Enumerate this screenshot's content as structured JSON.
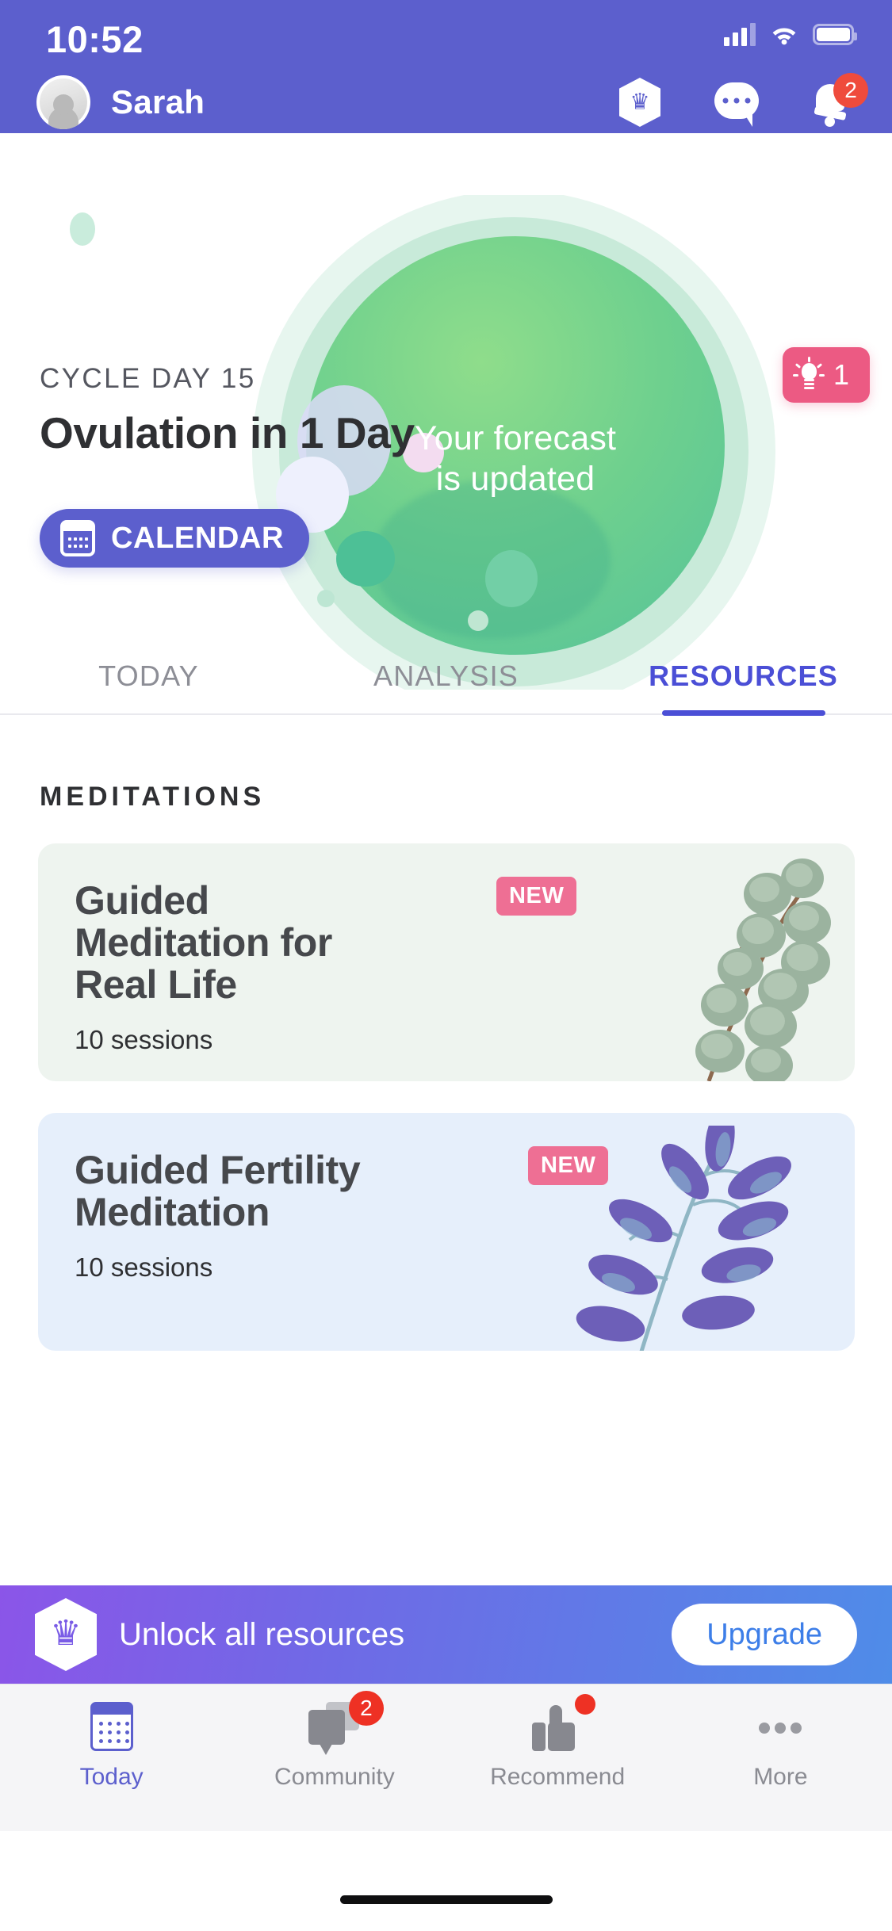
{
  "status_bar": {
    "time": "10:52",
    "icons": [
      "signal-icon",
      "wifi-icon",
      "battery-icon"
    ]
  },
  "header": {
    "user_name": "Sarah",
    "avatar": "avatar",
    "premium_icon": "crown-icon",
    "chat_icon": "chat-bubble-icon",
    "notifications_icon": "bell-icon",
    "notifications_count": "2"
  },
  "hero": {
    "cycle_day": "CYCLE DAY 15",
    "title": "Ovulation in 1 Day",
    "calendar_button": "CALENDAR",
    "calendar_icon": "calendar-icon",
    "forecast_line1": "Your forecast",
    "forecast_line2": "is updated",
    "tip_icon": "lightbulb-icon",
    "tip_count": "1",
    "accent_purple": "#5c5fcd",
    "accent_green": "#6ed08e",
    "accent_pink": "#ec5a83"
  },
  "tabs": [
    {
      "label": "TODAY",
      "active": false
    },
    {
      "label": "ANALYSIS",
      "active": false
    },
    {
      "label": "RESOURCES",
      "active": true
    }
  ],
  "content": {
    "section_title": "MEDITATIONS",
    "cards": [
      {
        "title_line1": "Guided",
        "title_line2": "Meditation for",
        "title_line3": "Real Life",
        "sessions": "10 sessions",
        "badge": "NEW",
        "bg_color": "#eef4ef",
        "art": "eucalyptus-branch-illustration"
      },
      {
        "title_line1": "Guided Fertility",
        "title_line2": "Meditation",
        "title_line3": "",
        "sessions": "10 sessions",
        "badge": "NEW",
        "bg_color": "#e6effb",
        "art": "purple-leaf-plant-illustration"
      }
    ]
  },
  "banner": {
    "icon": "crown-icon",
    "text": "Unlock all resources",
    "button_label": "Upgrade"
  },
  "nav": [
    {
      "label": "Today",
      "icon": "calendar-icon",
      "active": true,
      "badge": ""
    },
    {
      "label": "Community",
      "icon": "chat-icon",
      "active": false,
      "badge": "2"
    },
    {
      "label": "Recommend",
      "icon": "thumbs-up-icon",
      "active": false,
      "badge": "dot"
    },
    {
      "label": "More",
      "icon": "ellipsis-icon",
      "active": false,
      "badge": ""
    }
  ]
}
